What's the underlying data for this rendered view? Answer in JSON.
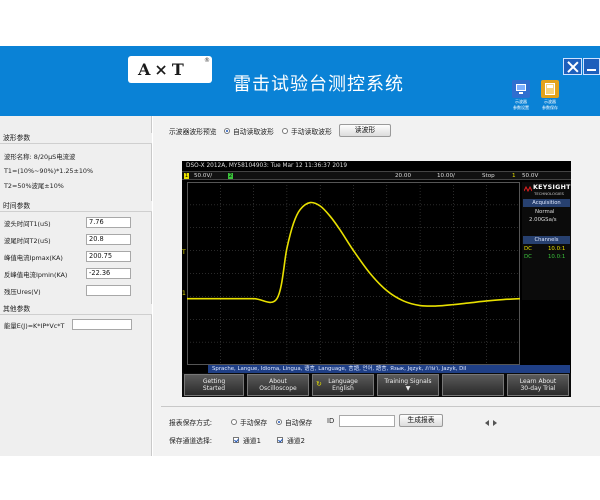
{
  "header": {
    "logo_text": "A×T",
    "logo_reg": "®",
    "title": "雷击试验台测控系统",
    "buttons": [
      {
        "label_line1": "示波器",
        "label_line2": "参数设置",
        "color": "#2f6fd0"
      },
      {
        "label_line1": "示波器",
        "label_line2": "参数保存",
        "color": "#e3a21a"
      }
    ]
  },
  "left": {
    "waveform_params": {
      "title": "波形参数",
      "lines": [
        "波形名称:  8/20μS电流波",
        "T1=(10%~90%)*1.25±10%",
        "T2=50%波尾±10%"
      ]
    },
    "time_params": {
      "title": "时间参数",
      "fields": [
        {
          "label": "波头时间T1(uS)",
          "value": "7.76"
        },
        {
          "label": "波尾时间T2(uS)",
          "value": "20.8"
        },
        {
          "label": "峰值电流Ipmax(KA)",
          "value": "200.75"
        },
        {
          "label": "反峰值电流Ipmin(KA)",
          "value": "-22.36"
        },
        {
          "label": "残压Ures(V)",
          "value": ""
        }
      ]
    },
    "other_params": {
      "title": "其他参数",
      "energy_label": "能量E(J)=K*IP*Vc*T",
      "energy_value": ""
    }
  },
  "topbar": {
    "label": "示波器波形预览",
    "auto_read": "自动读取波形",
    "manual_read": "手动读取波形",
    "read_button": "读波形",
    "mode": "auto"
  },
  "scope": {
    "title": "DSO-X 2012A, MY58104903: Tue Mar 12 11:36:37 2019",
    "status": {
      "ch1": "1",
      "ch1_scale": "50.0V/",
      "ch2": "2",
      "timebase_pos": "20.00",
      "timebase_scale": "10.00/",
      "run_state": "Stop",
      "trigger": "1",
      "trig_level": "50.0V"
    },
    "brand": "KEYSIGHT",
    "brand_sub": "TECHNOLOGIES",
    "acquisition": {
      "title": "Acquisition",
      "mode": "Normal",
      "rate": "2.00GSa/s"
    },
    "channels": {
      "title": "Channels",
      "rows": [
        {
          "coupling": "DC",
          "ratio": "10.0:1"
        },
        {
          "coupling": "DC",
          "ratio": "10.0:1"
        }
      ]
    },
    "language_bar": "Sprache, Langue, Idioma, Lingua, 语言, Language, 言語, 언어, 語言, Язык, Język, ภาษา, Jazyk, Dil",
    "softkeys": [
      {
        "line1": "Getting",
        "line2": "Started"
      },
      {
        "line1": "About",
        "line2": "Oscilloscope"
      },
      {
        "line1": "Language",
        "line2": "English"
      },
      {
        "line1": "Training Signals",
        "line2": ""
      },
      {
        "line1": "",
        "line2": ""
      },
      {
        "line1": "Learn About",
        "line2": "30-day Trial"
      }
    ],
    "colors": {
      "ch1": "#e8e000",
      "grid": "#555555",
      "background": "#000000"
    }
  },
  "chart_data": {
    "type": "line",
    "title": "",
    "xlabel": "",
    "ylabel": "",
    "x_divisions": 10,
    "y_divisions": 8,
    "x": [
      0,
      1,
      2,
      2.7,
      3,
      3.2,
      3.4,
      3.7,
      4.0,
      4.3,
      4.6,
      5.0,
      5.5,
      6.0,
      6.5,
      7.0,
      7.5,
      8.0,
      8.5,
      9.0,
      9.5,
      10
    ],
    "series": [
      {
        "values": [
          0,
          0,
          0,
          0,
          2.2,
          3.3,
          3.9,
          4.2,
          4.05,
          3.6,
          3.0,
          2.1,
          1.1,
          0.35,
          -0.1,
          -0.3,
          -0.32,
          -0.26,
          -0.18,
          -0.1,
          -0.04,
          0
        ],
        "color": "#e8e000"
      }
    ],
    "ylim": [
      -4,
      4
    ],
    "xlim": [
      0,
      10
    ]
  },
  "bottom": {
    "report_save": {
      "label": "报表保存方式:",
      "manual": "手动保存",
      "auto": "自动保存",
      "mode": "auto"
    },
    "id_label": "ID",
    "id_value": "",
    "generate_button": "生成报表",
    "channel_select": {
      "label": "保存通道选择:",
      "ch1": "通道1",
      "ch2": "通道2",
      "ch1_checked": true,
      "ch2_checked": true
    }
  }
}
